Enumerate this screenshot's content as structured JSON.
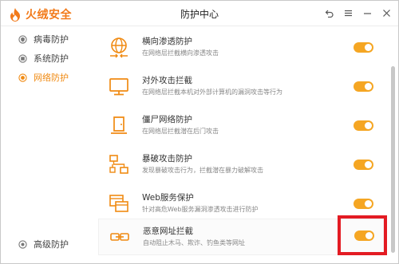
{
  "app": {
    "logo_text": "火绒安全",
    "window_title": "防护中心",
    "brand_color": "#f27a1a",
    "controls": [
      "back-icon",
      "menu-icon",
      "minimize-icon",
      "close-icon"
    ]
  },
  "sidebar": {
    "items": [
      {
        "label": "病毒防护",
        "icon": "shield-icon",
        "active": false
      },
      {
        "label": "系统防护",
        "icon": "system-icon",
        "active": false
      },
      {
        "label": "网络防护",
        "icon": "globe-icon",
        "active": true
      }
    ],
    "bottom_item": {
      "label": "高级防护",
      "icon": "advanced-icon"
    }
  },
  "rows": [
    {
      "title": "横向渗透防护",
      "desc": "在网络层拦截横向渗透攻击",
      "icon": "globe-arrows-icon",
      "enabled": true
    },
    {
      "title": "对外攻击拦截",
      "desc": "在网络层拦截本机对外部计算机的漏洞攻击等行为",
      "icon": "monitor-icon",
      "enabled": true
    },
    {
      "title": "僵尸网络防护",
      "desc": "在网络层拦截潜在后门攻击",
      "icon": "door-icon",
      "enabled": true
    },
    {
      "title": "暴破攻击防护",
      "desc": "发现暴破攻击行为，拦截潜在暴力破解攻击",
      "icon": "network-nodes-icon",
      "enabled": true
    },
    {
      "title": "Web服务保护",
      "desc": "针对高危Web服务漏洞渗透攻击进行防护",
      "icon": "web-windows-icon",
      "enabled": true
    },
    {
      "title": "恶意网址拦截",
      "desc": "自动阻止木马、欺诈、钓鱼类等网址",
      "icon": "link-icon",
      "enabled": true
    }
  ],
  "colors": {
    "accent": "#f5a623",
    "highlight": "#e31b23",
    "icon": "#f08a12"
  }
}
